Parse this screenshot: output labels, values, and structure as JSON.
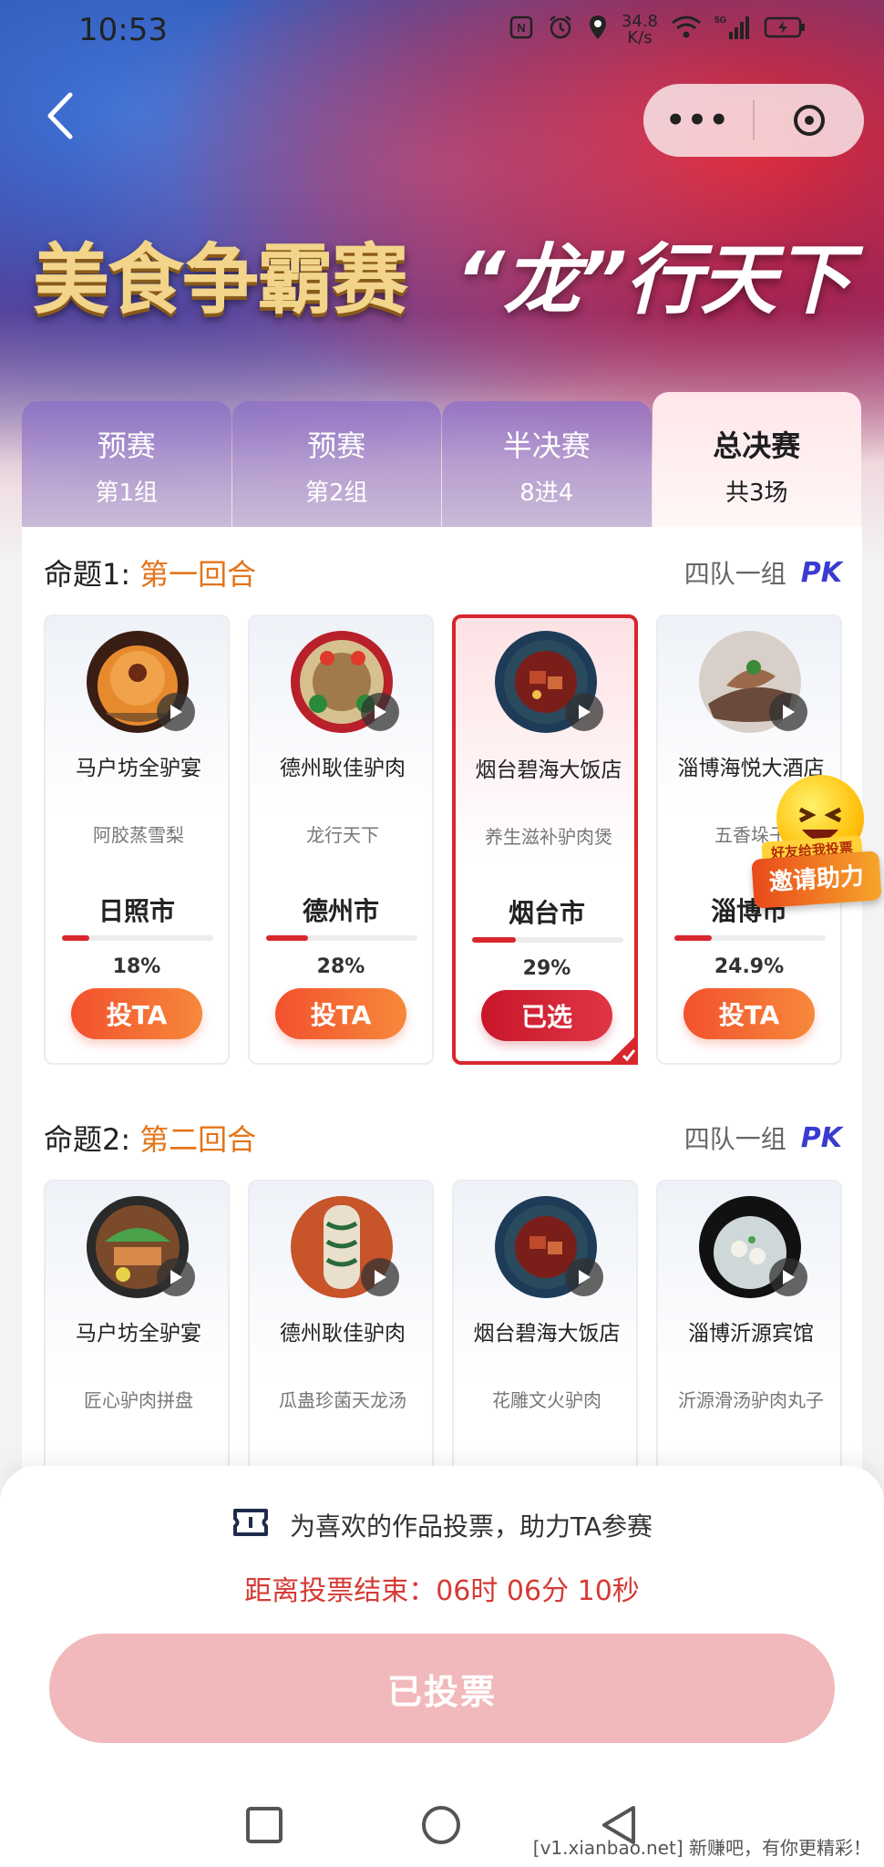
{
  "status_bar": {
    "time": "10:53",
    "speed_value": "34.8",
    "speed_unit": "K/s",
    "network": "5G"
  },
  "header": {
    "more_label": "•••",
    "title_left": "美食争霸赛",
    "title_right": "“龙”行天下"
  },
  "tabs": [
    {
      "label": "预赛",
      "sub": "第1组",
      "active": false
    },
    {
      "label": "预赛",
      "sub": "第2组",
      "active": false
    },
    {
      "label": "半决赛",
      "sub": "8进4",
      "active": false
    },
    {
      "label": "总决赛",
      "sub": "共3场",
      "active": true
    }
  ],
  "sections": [
    {
      "prefix": "命题1:",
      "round": "第一回合",
      "group_text": "四队一组",
      "pk": "PK",
      "cards": [
        {
          "name": "马户坊全驴宴",
          "dish": "阿胶蒸雪梨",
          "city": "日照市",
          "percent_text": "18%",
          "percent": 18,
          "button": "投TA",
          "selected": false
        },
        {
          "name": "德州耿佳驴肉",
          "dish": "龙行天下",
          "city": "德州市",
          "percent_text": "28%",
          "percent": 28,
          "button": "投TA",
          "selected": false
        },
        {
          "name": "烟台碧海大饭店",
          "dish": "养生滋补驴肉煲",
          "city": "烟台市",
          "percent_text": "29%",
          "percent": 29,
          "button": "已选",
          "selected": true
        },
        {
          "name": "淄博海悦大酒店",
          "dish": "五香垛子",
          "city": "淄博市",
          "percent_text": "24.9%",
          "percent": 24.9,
          "button": "投TA",
          "selected": false
        }
      ]
    },
    {
      "prefix": "命题2:",
      "round": "第二回合",
      "group_text": "四队一组",
      "pk": "PK",
      "cards": [
        {
          "name": "马户坊全驴宴",
          "dish": "匠心驴肉拼盘"
        },
        {
          "name": "德州耿佳驴肉",
          "dish": "瓜蛊珍菌天龙汤"
        },
        {
          "name": "烟台碧海大饭店",
          "dish": "花雕文火驴肉"
        },
        {
          "name": "淄博沂源宾馆",
          "dish": "沂源滑汤驴肉丸子"
        }
      ]
    }
  ],
  "helper": {
    "tag": "好友给我投票",
    "label": "邀请助力"
  },
  "bottom_sheet": {
    "tip": "为喜欢的作品投票，助力TA参赛",
    "countdown": "距离投票结束：06时 06分 10秒",
    "button": "已投票"
  },
  "watermark": "[v1.xianbao.net] 新赚吧，有你更精彩！",
  "colors": {
    "accent_red": "#d8262e",
    "orange": "#e4741a",
    "vote_button": "#f2512e"
  }
}
